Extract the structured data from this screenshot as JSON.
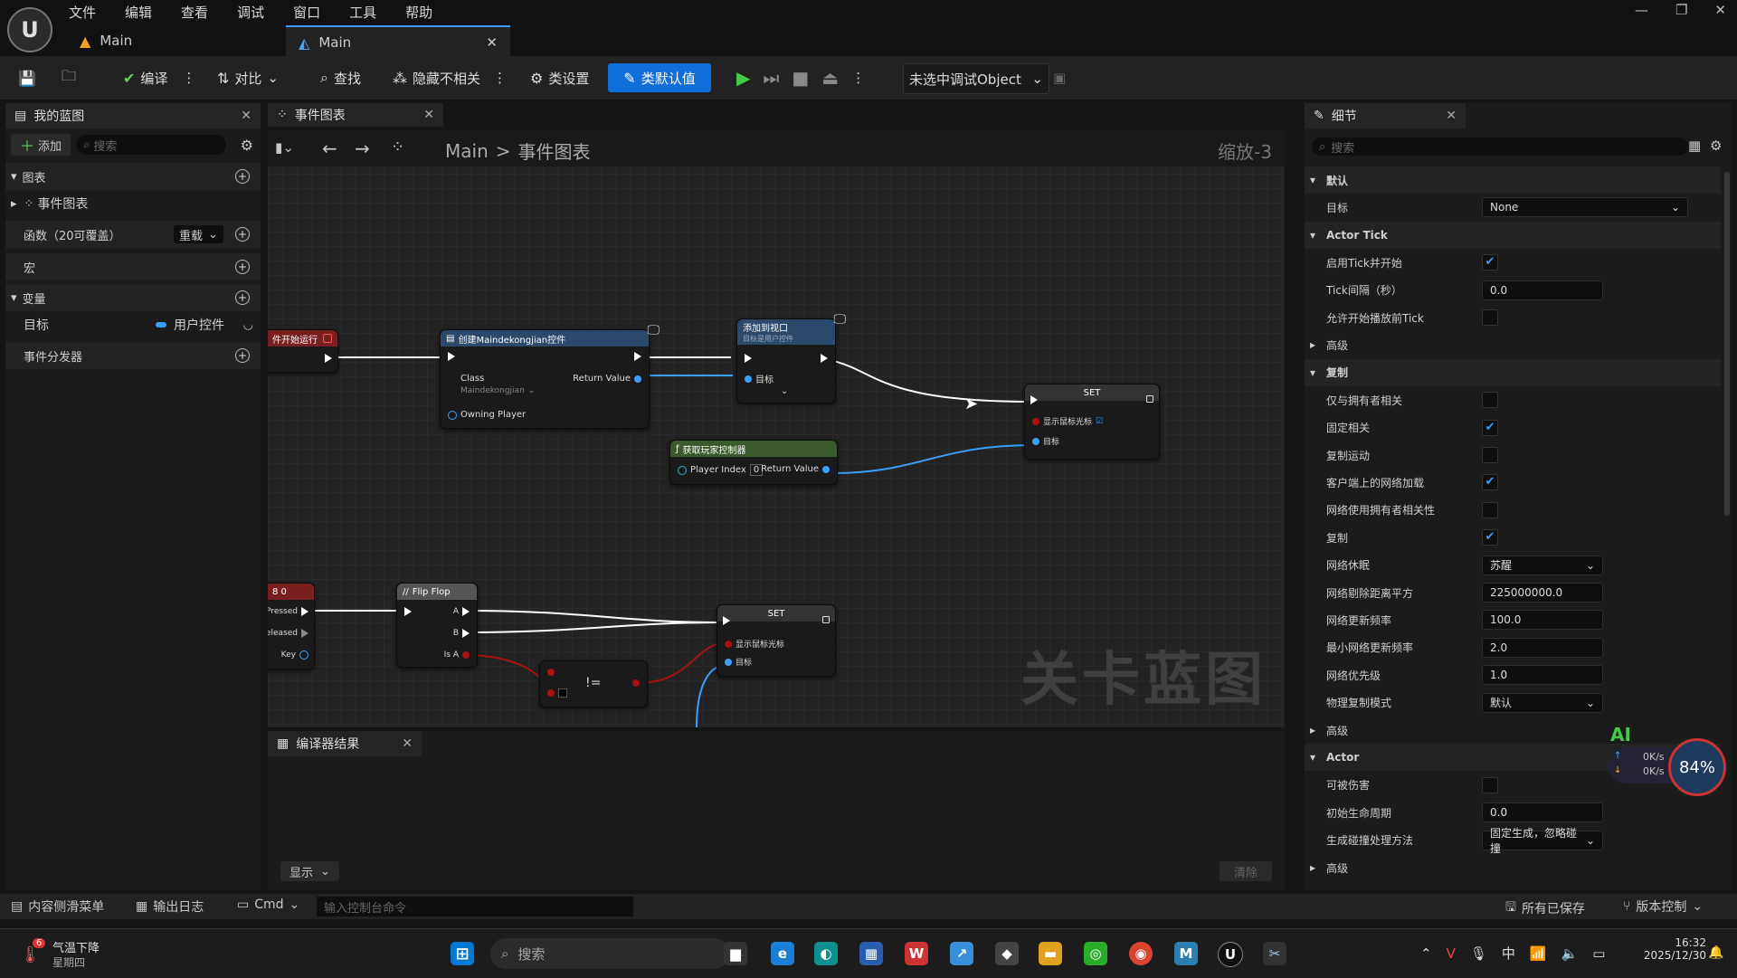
{
  "menu": [
    "文件",
    "编辑",
    "查看",
    "调试",
    "窗口",
    "工具",
    "帮助"
  ],
  "tabs": [
    {
      "label": "Main"
    },
    {
      "label": "Main"
    }
  ],
  "toolbar": {
    "compile": "编译",
    "diff": "对比",
    "find": "查找",
    "hide_unrelated": "隐藏不相关",
    "class_settings": "类设置",
    "class_defaults": "类默认值",
    "debug_object": "未选中调试Object"
  },
  "my_blueprint": {
    "title": "我的蓝图",
    "add": "添加",
    "search_placeholder": "搜索",
    "graphs": "图表",
    "event_graph": "事件图表",
    "functions": "函数（20可覆盖）",
    "override": "重载",
    "macros": "宏",
    "variables": "变量",
    "var_name": "目标",
    "var_type": "用户控件",
    "dispatchers": "事件分发器"
  },
  "graph": {
    "tab": "事件图表",
    "breadcrumb_root": "Main",
    "breadcrumb_sep": ">",
    "breadcrumb_leaf": "事件图表",
    "zoom": "缩放-3",
    "watermark": "关卡蓝图",
    "nodes": {
      "begin": "件开始运行",
      "create": "创建Maindekongjian控件",
      "create_class": "Class",
      "create_class_val": "Maindekongjian",
      "create_return": "Return Value",
      "create_owner": "Owning Player",
      "add_viewport": "添加到视口",
      "add_viewport_sub": "目标是用户控件",
      "add_target": "目标",
      "set1": "SET",
      "set1_show": "显示鼠标光标",
      "set1_target": "目标",
      "get_pc": "获取玩家控制器",
      "get_pc_index": "Player Index",
      "get_pc_index_val": "0",
      "get_pc_return": "Return Value",
      "key": "8 0",
      "key_pressed": "Pressed",
      "key_released": "eleased",
      "key_key": "Key",
      "flipflop": "Flip Flop",
      "ff_a": "A",
      "ff_b": "B",
      "ff_isa": "Is A",
      "neq": "!=",
      "set2": "SET",
      "set2_show": "显示鼠标光标",
      "set2_target": "目标"
    }
  },
  "compiler": {
    "title": "编译器结果",
    "show": "显示",
    "clear": "清除"
  },
  "details": {
    "title": "细节",
    "search_placeholder": "搜索",
    "rows": [
      {
        "type": "section",
        "label": "默认"
      },
      {
        "type": "dropdown",
        "label": "目标",
        "value": "None"
      },
      {
        "type": "section",
        "label": "Actor Tick"
      },
      {
        "type": "check",
        "label": "启用Tick并开始",
        "checked": true
      },
      {
        "type": "text",
        "label": "Tick间隔（秒）",
        "value": "0.0"
      },
      {
        "type": "check",
        "label": "允许开始播放前Tick",
        "checked": false
      },
      {
        "type": "collapsed",
        "label": "高级"
      },
      {
        "type": "section",
        "label": "复制"
      },
      {
        "type": "check",
        "label": "仅与拥有者相关",
        "checked": false
      },
      {
        "type": "check",
        "label": "固定相关",
        "checked": true
      },
      {
        "type": "check",
        "label": "复制运动",
        "checked": false
      },
      {
        "type": "check",
        "label": "客户端上的网络加载",
        "checked": true
      },
      {
        "type": "check",
        "label": "网络使用拥有者相关性",
        "checked": false
      },
      {
        "type": "check",
        "label": "复制",
        "checked": true
      },
      {
        "type": "dropdown",
        "label": "网络休眠",
        "value": "苏醒"
      },
      {
        "type": "text",
        "label": "网络剔除距离平方",
        "value": "225000000.0"
      },
      {
        "type": "text",
        "label": "网络更新频率",
        "value": "100.0"
      },
      {
        "type": "text",
        "label": "最小网络更新频率",
        "value": "2.0"
      },
      {
        "type": "text",
        "label": "网络优先级",
        "value": "1.0"
      },
      {
        "type": "dropdown",
        "label": "物理复制模式",
        "value": "默认"
      },
      {
        "type": "collapsed",
        "label": "高级"
      },
      {
        "type": "section",
        "label": "Actor"
      },
      {
        "type": "check",
        "label": "可被伤害",
        "checked": false
      },
      {
        "type": "text",
        "label": "初始生命周期",
        "value": "0.0"
      },
      {
        "type": "dropdown",
        "label": "生成碰撞处理方法",
        "value": "固定生成，忽略碰撞"
      },
      {
        "type": "collapsed",
        "label": "高级"
      }
    ]
  },
  "net_overlay": {
    "ai": "AI",
    "up": "0K/s",
    "down": "0K/s",
    "percent": "84%"
  },
  "statusbar": {
    "content_drawer": "内容侧滑菜单",
    "output_log": "输出日志",
    "cmd": "Cmd",
    "console_placeholder": "输入控制台命令",
    "all_saved": "所有已保存",
    "source_control": "版本控制"
  },
  "taskbar": {
    "weather_badge": "6",
    "weather": "气温下降",
    "weekday": "星期四",
    "search": "搜索",
    "time": "16:32",
    "date": "2025/12/30"
  },
  "colors": {
    "accent": "#0f6ed9",
    "exec_head": "#7a1f1f",
    "func_head": "#2b4a6b",
    "pure_head": "#3a5a2a"
  }
}
